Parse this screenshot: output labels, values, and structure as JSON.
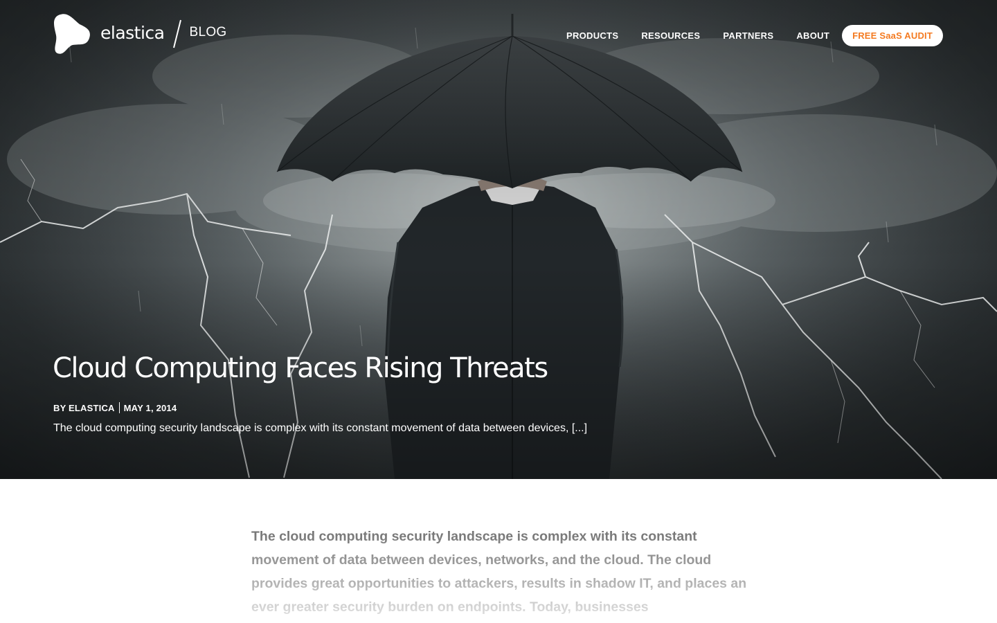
{
  "header": {
    "logo_text": "elastica",
    "section_label": "BLOG",
    "nav": [
      "PRODUCTS",
      "RESOURCES",
      "PARTNERS",
      "ABOUT"
    ],
    "cta_label": "FREE SaaS AUDIT"
  },
  "hero": {
    "title": "Cloud Computing Faces Rising Threats",
    "byline": "BY ELASTICA",
    "date": "MAY 1, 2014",
    "excerpt": "The cloud computing security landscape is complex with its constant movement of data between devices, ",
    "read_more": "[...]",
    "image_description_icon": "businessman-umbrella-storm-image"
  },
  "article": {
    "body": "The cloud computing security landscape is complex with its constant movement of data between devices, networks, and the cloud. The cloud provides great opportunities to attackers, results in shadow IT, and places an ever greater security burden on endpoints. Today, businesses"
  },
  "colors": {
    "accent": "#f47a20",
    "body_text": "#6f6f6f",
    "hero_dark": "#2a2f31"
  }
}
